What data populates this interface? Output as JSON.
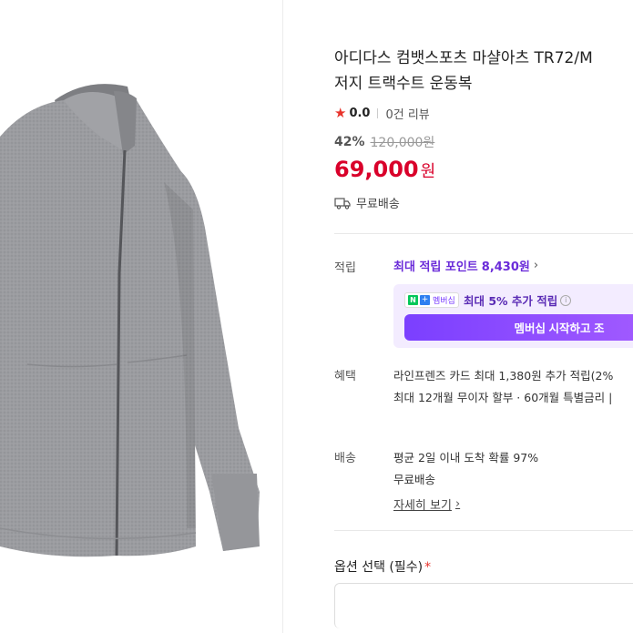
{
  "product": {
    "title_line1": "아디다스 컴뱃스포츠 마샬아츠 TR72/M",
    "title_line2": "저지 트랙수트 운동복",
    "rating": "0.0",
    "review_count": "0건 리뷰",
    "discount_rate": "42%",
    "original_price": "120,000원",
    "price": "69,000",
    "price_unit": "원",
    "shipping_tag": "무료배송"
  },
  "benefits": {
    "points_label": "적립",
    "points_text": "최대 적립 포인트",
    "points_value": "8,430원",
    "membership_badge": "멤버십",
    "membership_text": "최대 5% 추가 적립",
    "membership_button": "멤버십 시작하고 조",
    "benefit_label": "혜택",
    "benefit_line1": "라인프렌즈 카드 최대 1,380원 추가 적립(2%",
    "benefit_line2": "최대 12개월 무이자 할부 · 60개월 특별금리 |"
  },
  "delivery": {
    "label": "배송",
    "line1": "평균 2일 이내 도착 확률 97%",
    "line2": "무료배송",
    "detail_link": "자세히 보기"
  },
  "options": {
    "label": "옵션 선택 (필수)",
    "required_mark": "*"
  },
  "icons": {
    "rating": "star-icon",
    "shipping": "truck-icon",
    "chevron": "chevron-right-icon",
    "info": "info-icon"
  },
  "colors": {
    "price_red": "#d9002a",
    "membership_purple": "#7b3fff",
    "star_red": "#e8332b"
  }
}
